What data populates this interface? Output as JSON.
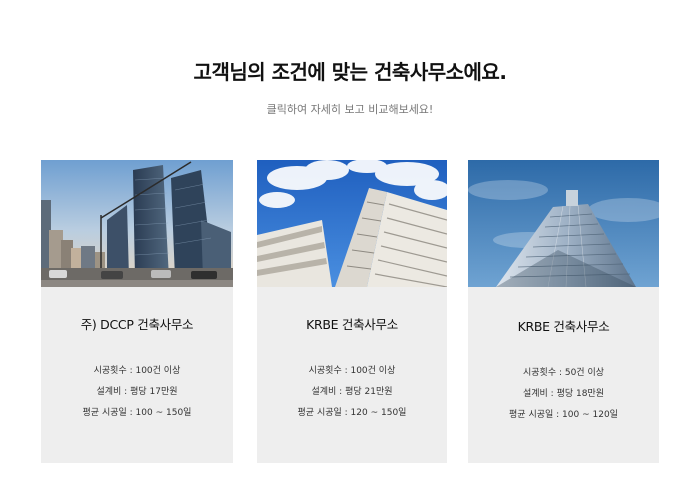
{
  "header": {
    "title": "고객님의 조건에 맞는 건축사무소에요.",
    "subtitle": "클릭하여 자세히 보고 비교해보세요!"
  },
  "offices": [
    {
      "name": "주) DCCP 건축사무소",
      "construction_count": "시공횟수 : 100건 이상",
      "design_fee": "설계비 : 평당 17만원",
      "avg_period": "평균 시공일 : 100 ~ 150일"
    },
    {
      "name": "KRBE 건축사무소",
      "construction_count": "시공횟수 : 100건 이상",
      "design_fee": "설계비 : 평당 21만원",
      "avg_period": "평균 시공일 : 120 ~ 150일"
    },
    {
      "name": "KRBE 건축사무소",
      "construction_count": "시공횟수 : 50건 이상",
      "design_fee": "설계비 : 평당 18만원",
      "avg_period": "평균 시공일 : 100 ~ 120일"
    }
  ],
  "colors": {
    "card_background": "#eeeeee",
    "title": "#111111",
    "subtitle": "#777777"
  }
}
